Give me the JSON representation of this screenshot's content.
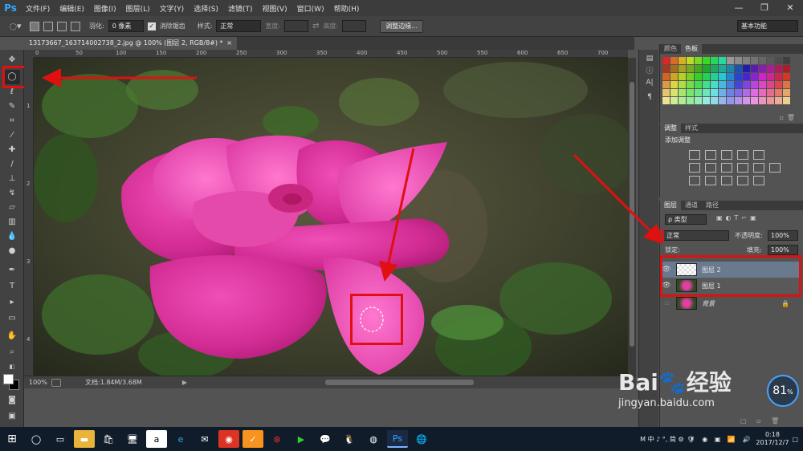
{
  "app": {
    "logo": "Ps",
    "menus": [
      "文件(F)",
      "编辑(E)",
      "图像(I)",
      "图层(L)",
      "文字(Y)",
      "选择(S)",
      "滤镜(T)",
      "视图(V)",
      "窗口(W)",
      "帮助(H)"
    ],
    "window_controls": [
      "—",
      "❐",
      "✕"
    ]
  },
  "options": {
    "feather_label": "羽化:",
    "feather_value": "0 像素",
    "antialias_label": "消除锯齿",
    "style_label": "样式:",
    "style_value": "正常",
    "width_label": "宽度:",
    "height_label": "高度:",
    "refine_edge": "调整边缘...",
    "workspace": "基本功能"
  },
  "document": {
    "tab_title": "13173667_163714002738_2.jpg @ 100% (图层 2, RGB/8#) *",
    "tab_close": "×",
    "zoom": "100%",
    "doc_size": "文档:1.84M/3.68M"
  },
  "rulers": {
    "h_ticks": [
      "0",
      "50",
      "100",
      "150",
      "200",
      "250",
      "300",
      "350",
      "400",
      "450",
      "500",
      "550",
      "600",
      "650",
      "700"
    ],
    "v_ticks": [
      "1",
      "2",
      "3",
      "4"
    ]
  },
  "panels": {
    "color_tabs": [
      "颜色",
      "色板"
    ],
    "adjust_tabs": [
      "调整",
      "样式"
    ],
    "adjust_title": "添加调整",
    "layer_tabs": [
      "图层",
      "通道",
      "路径"
    ],
    "kind_filter": "ρ 类型",
    "blend_mode": "正常",
    "opacity_label": "不透明度:",
    "opacity_value": "100%",
    "lock_label": "锁定:",
    "fill_label": "填充:",
    "fill_value": "100%",
    "layers": [
      {
        "name": "图层 2",
        "selected": true
      },
      {
        "name": "图层 1",
        "selected": false
      },
      {
        "name": "背景",
        "selected": false
      }
    ]
  },
  "taskbar": {
    "ime": "M 中 ♪ °, 简 ⚙",
    "time": "0:18",
    "date": "2017/12/7"
  },
  "watermark": {
    "brand": "Bai",
    "brand2": "经验",
    "url": "jingyan.baidu.com",
    "speed": "81",
    "speed_unit": "%"
  },
  "colors": {
    "accent_red": "#e01010",
    "ps_blue": "#31a8ff"
  }
}
